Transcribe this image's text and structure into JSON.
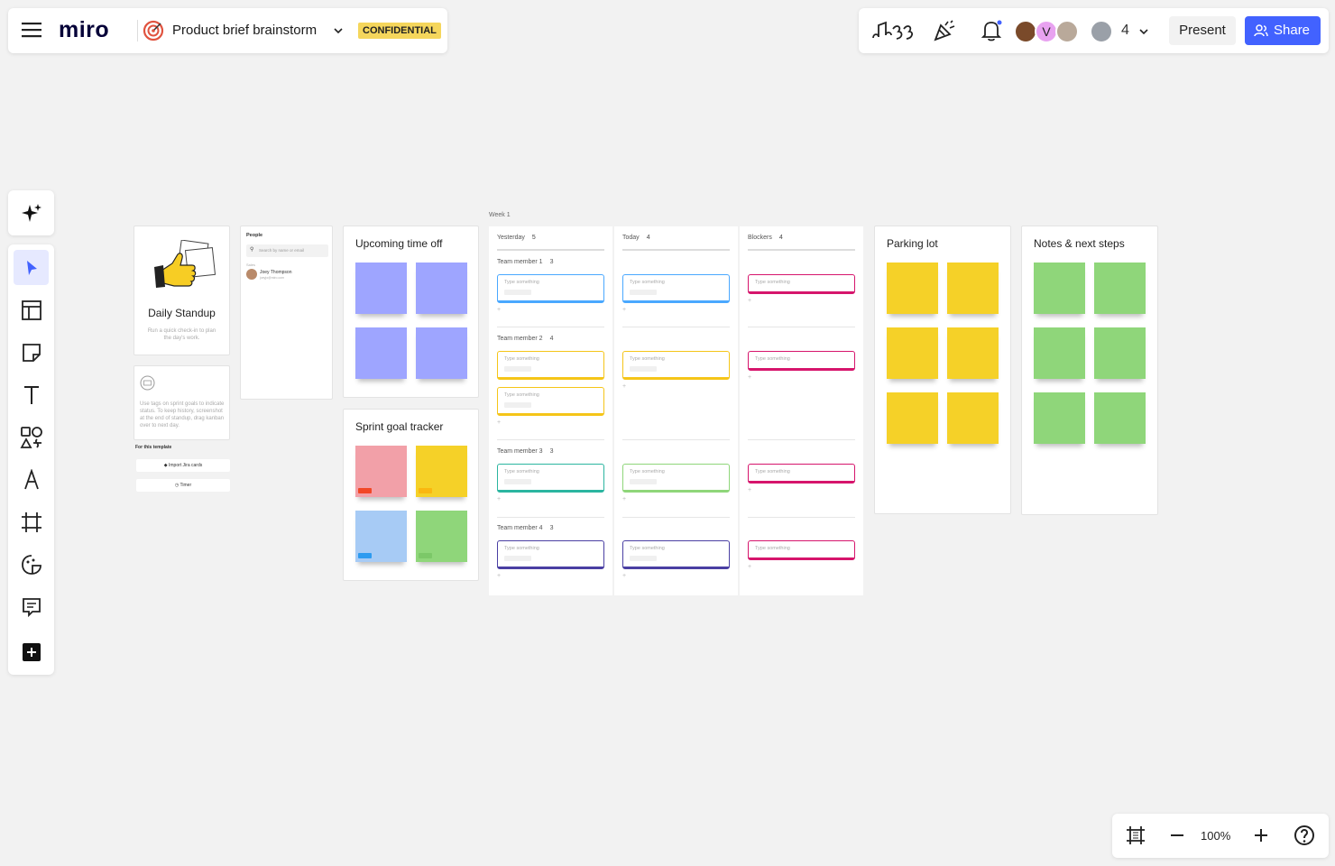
{
  "app": {
    "logo": "miro",
    "board_title": "Product brief brainstorm",
    "badge": "CONFIDENTIAL"
  },
  "topbar": {
    "collaborator_count": "4",
    "present_label": "Present",
    "share_label": "Share",
    "avatar_letter": "V"
  },
  "zoom": {
    "level": "100%"
  },
  "colors": {
    "accent": "#4262ff",
    "badge": "#f5d65c",
    "purple_sticky": "#9ea5ff",
    "yellow_sticky": "#f5d128",
    "green_sticky": "#8fd67a",
    "pink_sticky": "#f2a0a8",
    "blue_sticky": "#a7cbf5"
  },
  "toolbar": [
    "sparkle-icon",
    "select-cursor-icon",
    "templates-icon",
    "sticky-note-icon",
    "text-icon",
    "shapes-icon",
    "pen-icon",
    "frame-icon",
    "sticker-icon",
    "comment-icon",
    "more-tools-icon"
  ],
  "canvas": {
    "standup_card": {
      "title": "Daily Standup",
      "subtitle": "Run a quick check-in to plan the day's work."
    },
    "info_card": {
      "text": "Use tags on sprint goals to indicate status. To keep history, screenshot at the end of standup, drag kanban over to next day.",
      "section": "For this template",
      "button_jira": "Import Jira cards",
      "button_timer": "Timer"
    },
    "people_card": {
      "title": "People",
      "search_placeholder": "Search by name or email",
      "section": "Sales",
      "person_name": "Joey Thompson",
      "person_email": "joeyjo@miro.com"
    },
    "time_off": {
      "title": "Upcoming time off"
    },
    "sprint": {
      "title": "Sprint goal tracker"
    },
    "week_label": "Week 1",
    "columns": [
      {
        "name": "Yesterday",
        "count": "5"
      },
      {
        "name": "Today",
        "count": "4"
      },
      {
        "name": "Blockers",
        "count": "4"
      }
    ],
    "rows": [
      {
        "name": "Team member 1",
        "count": "3"
      },
      {
        "name": "Team member 2",
        "count": "4"
      },
      {
        "name": "Team member 3",
        "count": "3"
      },
      {
        "name": "Team member 4",
        "count": "3"
      }
    ],
    "input_placeholder": "Type something",
    "plus": "+",
    "parking_lot": {
      "title": "Parking lot"
    },
    "notes": {
      "title": "Notes & next steps"
    }
  }
}
